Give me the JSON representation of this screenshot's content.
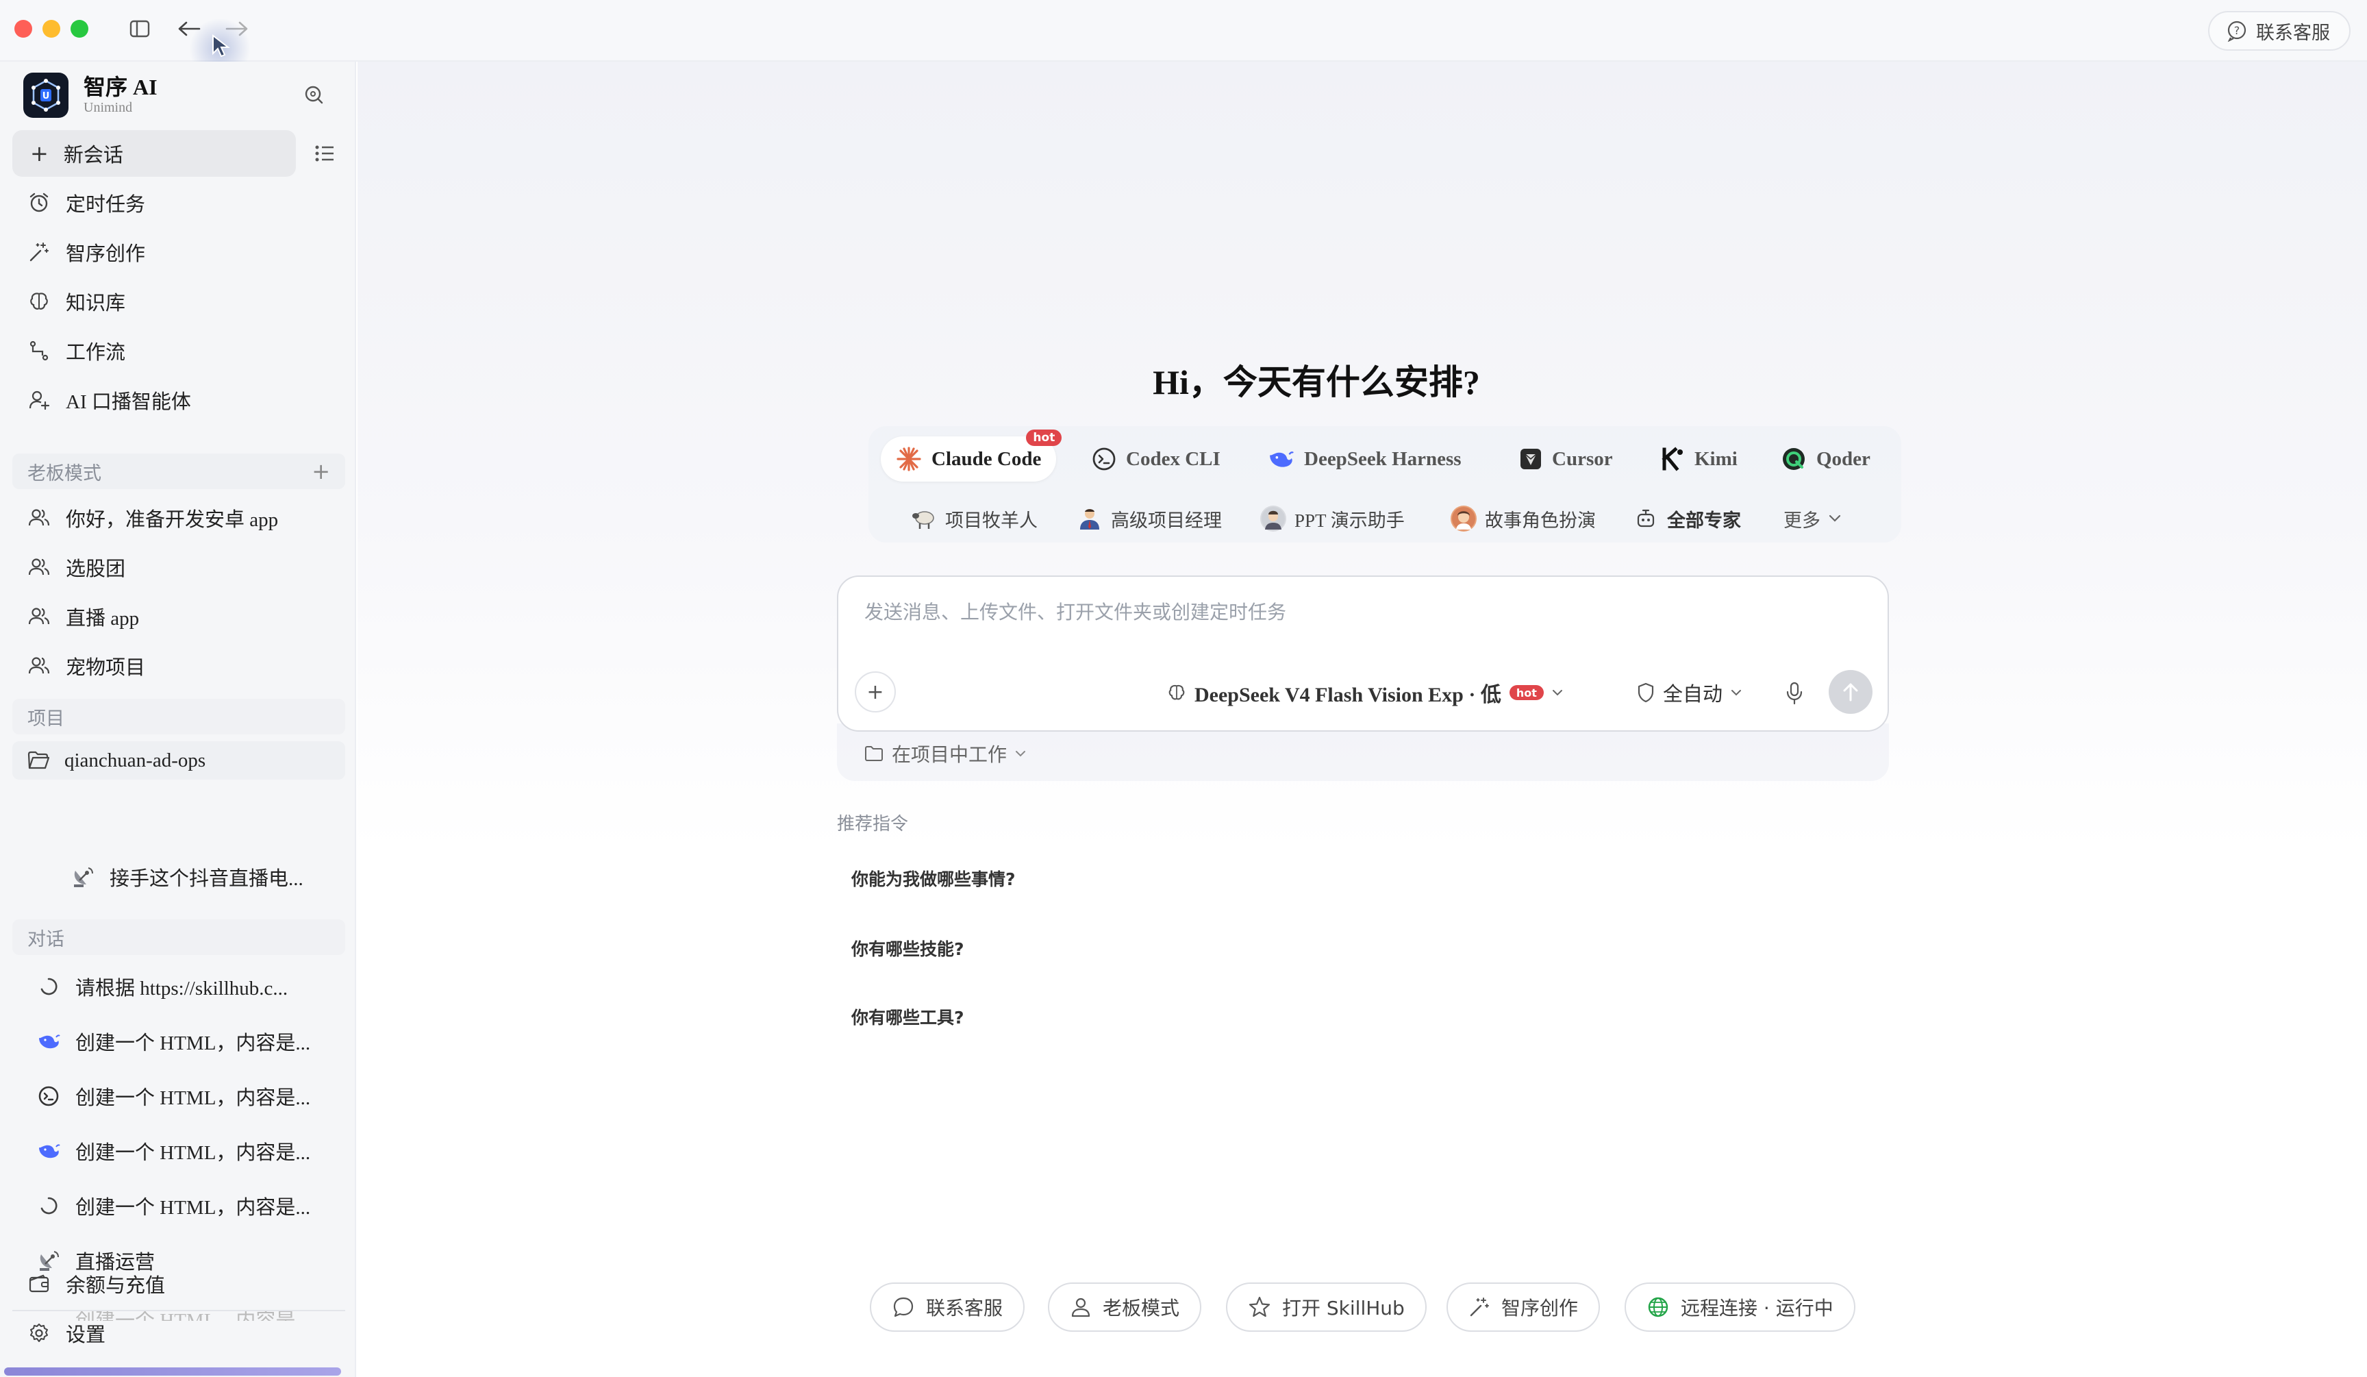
{
  "window": {
    "support_label": "联系客服"
  },
  "brand": {
    "name": "智序 AI",
    "sub": "Unimind"
  },
  "sidebar": {
    "new_chat": "新会话",
    "nav": [
      {
        "label": "定时任务",
        "icon": "alarm-clock-icon"
      },
      {
        "label": "智序创作",
        "icon": "magic-wand-icon"
      },
      {
        "label": "知识库",
        "icon": "brain-icon"
      },
      {
        "label": "工作流",
        "icon": "workflow-icon"
      },
      {
        "label": "AI 口播智能体",
        "icon": "user-plus-icon"
      }
    ],
    "boss_section": "老板模式",
    "boss_items": [
      "你好，准备开发安卓 app",
      "选股团",
      "直播 app",
      "宠物项目"
    ],
    "project_section": "项目",
    "project_name": "qianchuan-ad-ops",
    "project_sub": "接手这个抖音直播电...",
    "chat_section": "对话",
    "chats": [
      {
        "label": "请根据 https://skillhub.c...",
        "icon": "loading-spinner-icon"
      },
      {
        "label": "创建一个 HTML，内容是...",
        "icon": "deepseek-whale-icon"
      },
      {
        "label": "创建一个 HTML，内容是...",
        "icon": "codex-terminal-icon"
      },
      {
        "label": "创建一个 HTML，内容是...",
        "icon": "deepseek-whale-icon"
      },
      {
        "label": "创建一个 HTML，内容是...",
        "icon": "loading-spinner-icon"
      },
      {
        "label": "直播运营",
        "icon": "satellite-dish-icon"
      }
    ],
    "chat_overflow": "创建一个 HTML，内容是...",
    "balance": "余额与充值",
    "settings": "设置"
  },
  "main": {
    "greeting": "Hi，今天有什么安排?",
    "agents": [
      {
        "label": "Claude Code",
        "badge": "hot"
      },
      {
        "label": "Codex CLI"
      },
      {
        "label": "DeepSeek Harness"
      },
      {
        "label": "Cursor"
      },
      {
        "label": "Kimi"
      },
      {
        "label": "Qoder"
      }
    ],
    "experts": [
      "项目牧羊人",
      "高级项目经理",
      "PPT 演示助手",
      "故事角色扮演",
      "全部专家",
      "更多"
    ],
    "composer": {
      "placeholder": "发送消息、上传文件、打开文件夹或创建定时任务",
      "model": "DeepSeek V4 Flash Vision Exp · 低",
      "model_badge": "hot",
      "mode": "全自动"
    },
    "project_work": "在项目中工作",
    "suggest_title": "推荐指令",
    "suggestions": [
      "你能为我做哪些事情?",
      "你有哪些技能?",
      "你有哪些工具?"
    ],
    "bottom": [
      "联系客服",
      "老板模式",
      "打开 SkillHub",
      "智序创作",
      "远程连接 · 运行中"
    ]
  },
  "colors": {
    "accent_hot": "#e0454a",
    "claude_orange": "#e26a45",
    "deepseek_blue": "#4d6bfe",
    "remote_green": "#22a447"
  }
}
